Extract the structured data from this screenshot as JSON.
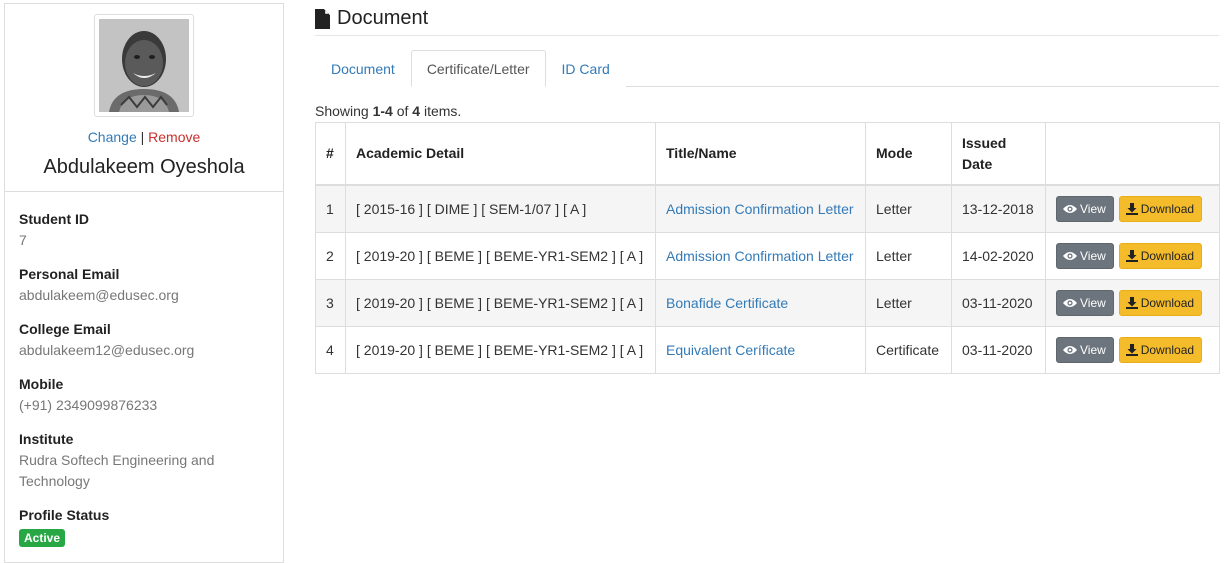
{
  "profile": {
    "change_label": "Change",
    "separator": "|",
    "remove_label": "Remove",
    "name": "Abdulakeem Oyeshola",
    "fields": [
      {
        "label": "Student ID",
        "value": "7"
      },
      {
        "label": "Personal Email",
        "value": "abdulakeem@edusec.org"
      },
      {
        "label": "College Email",
        "value": "abdulakeem12@edusec.org"
      },
      {
        "label": "Mobile",
        "value": "(+91) 2349099876233"
      },
      {
        "label": "Institute",
        "value": "Rudra Softech Engineering and Technology"
      }
    ],
    "status_label": "Profile Status",
    "status_value": "Active"
  },
  "header": {
    "title": "Document",
    "icon": "file-icon"
  },
  "tabs": [
    {
      "label": "Document",
      "active": false
    },
    {
      "label": "Certificate/Letter",
      "active": true
    },
    {
      "label": "ID Card",
      "active": false
    }
  ],
  "summary": {
    "prefix": "Showing ",
    "range": "1-4",
    "middle": " of ",
    "total": "4",
    "suffix": " items."
  },
  "table": {
    "columns": [
      "#",
      "Academic Detail",
      "Title/Name",
      "Mode",
      "Issued Date",
      ""
    ],
    "rows": [
      {
        "num": "1",
        "academic": "[ 2015-16 ] [ DIME ] [ SEM-1/07 ] [ A ]",
        "title": "Admission Confirmation Letter",
        "mode": "Letter",
        "date": "13-12-2018"
      },
      {
        "num": "2",
        "academic": "[ 2019-20 ] [ BEME ] [ BEME-YR1-SEM2 ] [ A ]",
        "title": "Admission Confirmation Letter",
        "mode": "Letter",
        "date": "14-02-2020"
      },
      {
        "num": "3",
        "academic": "[ 2019-20 ] [ BEME ] [ BEME-YR1-SEM2 ] [ A ]",
        "title": "Bonafide Certificate",
        "mode": "Letter",
        "date": "03-11-2020"
      },
      {
        "num": "4",
        "academic": "[ 2019-20 ] [ BEME ] [ BEME-YR1-SEM2 ] [ A ]",
        "title": "Equivalent Ceríficate",
        "mode": "Certificate",
        "date": "03-11-2020"
      }
    ],
    "view_label": "View",
    "download_label": "Download"
  },
  "colors": {
    "link": "#337ab7",
    "remove": "#c9302c",
    "badge_active": "#28a745",
    "btn_view": "#6c757d",
    "btn_download": "#f4bc2b",
    "row_stripe": "#f5f5f5"
  }
}
